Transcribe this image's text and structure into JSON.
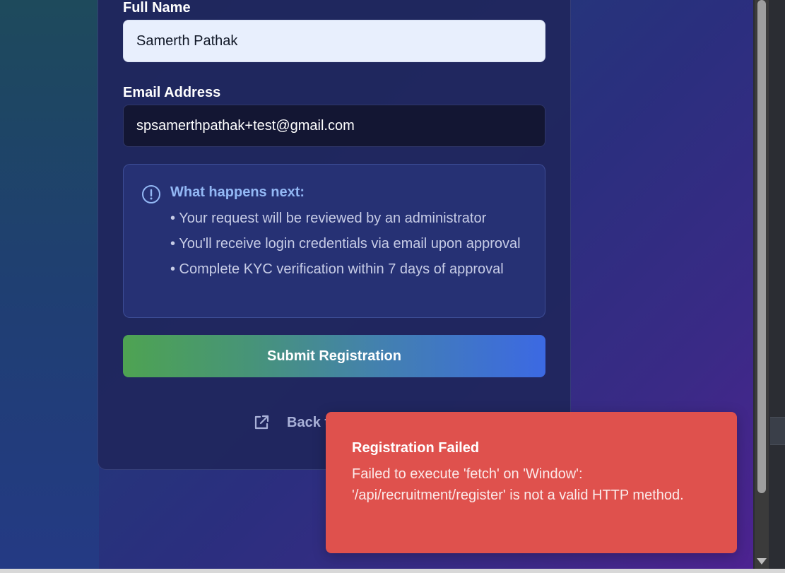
{
  "form": {
    "full_name_label": "Full Name",
    "full_name_value": "Samerth Pathak",
    "email_label": "Email Address",
    "email_value": "spsamerthpathak+test@gmail.com"
  },
  "info": {
    "icon": "info-circle-icon",
    "title": "What happens next:",
    "items": [
      "• Your request will be reviewed by an administrator",
      "• You'll receive login credentials via email upon approval",
      "• Complete KYC verification within 7 days of approval"
    ]
  },
  "actions": {
    "submit_label": "Submit Registration",
    "back_label_visible": "Back t",
    "back_icon": "external-link-icon"
  },
  "toast": {
    "title": "Registration Failed",
    "message": "Failed to execute 'fetch' on 'Window': '/api/recruitment/register' is not a valid HTTP method."
  },
  "colors": {
    "accent_blue": "#93b8f5",
    "toast_red": "#df514d",
    "button_green": "#4ea352",
    "button_blue": "#3c69e3"
  }
}
